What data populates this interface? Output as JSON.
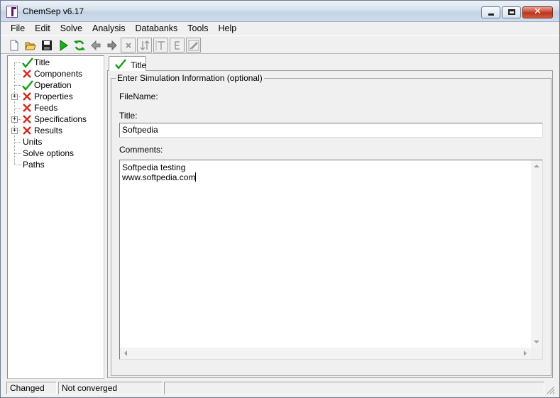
{
  "window": {
    "title": "ChemSep v6.17"
  },
  "menu": [
    "File",
    "Edit",
    "Solve",
    "Analysis",
    "Databanks",
    "Tools",
    "Help"
  ],
  "toolbar": {
    "buttons": [
      {
        "name": "new-file-icon"
      },
      {
        "name": "open-folder-icon"
      },
      {
        "name": "save-disk-icon"
      },
      {
        "name": "solve-play-icon"
      },
      {
        "name": "refresh-icon"
      },
      {
        "name": "back-arrow-icon"
      },
      {
        "name": "forward-arrow-icon"
      },
      {
        "name": "delete-x-icon"
      },
      {
        "name": "swap-icon"
      },
      {
        "name": "text-t-icon"
      },
      {
        "name": "text-e-icon"
      },
      {
        "name": "pencil-ruler-icon"
      }
    ]
  },
  "tree": {
    "items": [
      {
        "label": "Title",
        "status": "check",
        "expandable": false
      },
      {
        "label": "Components",
        "status": "cross",
        "expandable": false
      },
      {
        "label": "Operation",
        "status": "check",
        "expandable": false
      },
      {
        "label": "Properties",
        "status": "cross",
        "expandable": true
      },
      {
        "label": "Feeds",
        "status": "cross",
        "expandable": false
      },
      {
        "label": "Specifications",
        "status": "cross",
        "expandable": true
      },
      {
        "label": "Results",
        "status": "cross",
        "expandable": true
      },
      {
        "label": "Units",
        "status": "none",
        "expandable": false
      },
      {
        "label": "Solve options",
        "status": "none",
        "expandable": false
      },
      {
        "label": "Paths",
        "status": "none",
        "expandable": false
      }
    ],
    "expander_glyph": "+"
  },
  "tab": {
    "label": "Title"
  },
  "form": {
    "group_title": "Enter Simulation Information (optional)",
    "filename_label": "FileName:",
    "title_label": "Title:",
    "title_value": "Softpedia",
    "comments_label": "Comments:",
    "comments_line1": "Softpedia testing",
    "comments_line2": "www.softpedia.com"
  },
  "status": {
    "cell1": "Changed",
    "cell2": "Not converged",
    "cell3": ""
  },
  "colors": {
    "check": "#1aa01a",
    "cross": "#d42a1a",
    "play": "#18b018"
  }
}
